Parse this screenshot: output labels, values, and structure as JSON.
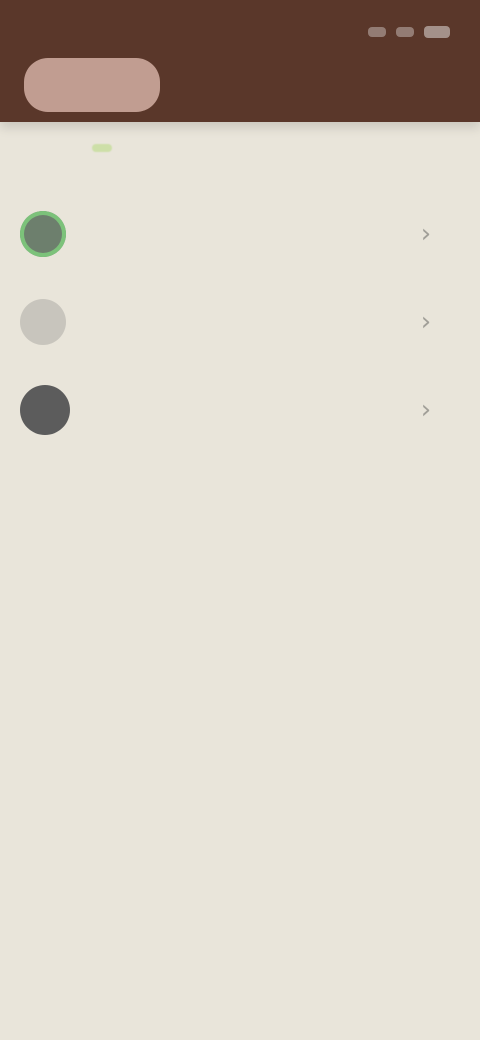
{
  "status": {
    "time": "",
    "icons": [
      "signal-icon",
      "wifi-icon",
      "battery-icon"
    ]
  },
  "header": {
    "pill_label": ""
  },
  "filter": {
    "label": ""
  },
  "list": {
    "items": [
      {
        "title": "",
        "subtitle": "",
        "avatar_style": "green"
      },
      {
        "title": "",
        "subtitle": "",
        "avatar_style": "gray"
      },
      {
        "title": "",
        "subtitle": "",
        "avatar_style": "dark"
      }
    ]
  },
  "colors": {
    "header": "#5a372a",
    "background": "#e9e5da",
    "pill": "#c19d91",
    "filter_tag": "#cddfa8"
  }
}
